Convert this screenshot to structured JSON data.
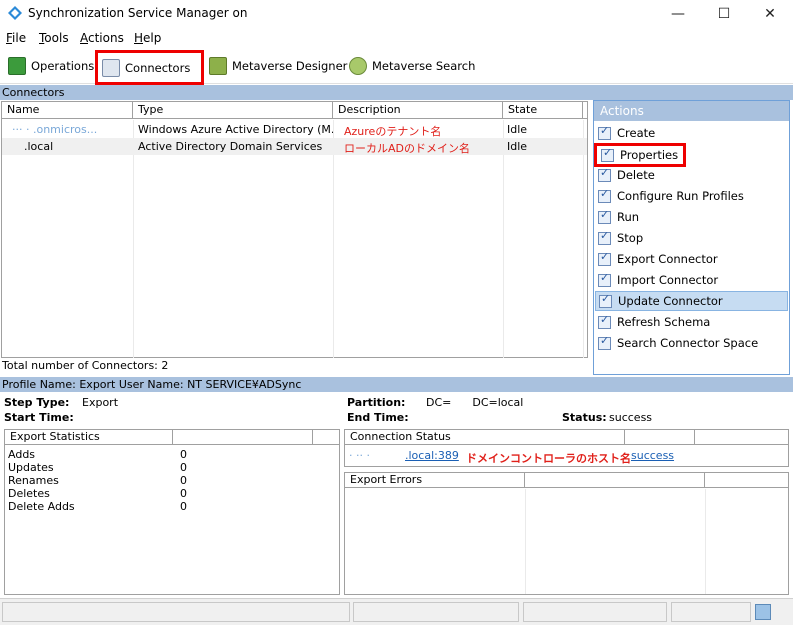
{
  "window": {
    "title": "Synchronization Service Manager on",
    "min": "—",
    "max": "☐",
    "close": "✕"
  },
  "menu": [
    "File",
    "Tools",
    "Actions",
    "Help"
  ],
  "toolbar": {
    "operations": "Operations",
    "connectors": "Connectors",
    "metaverse_designer": "Metaverse Designer",
    "metaverse_search": "Metaverse Search"
  },
  "connectors": {
    "section_title": "Connectors",
    "columns": [
      "Name",
      "Type",
      "Description",
      "State"
    ],
    "rows": [
      {
        "name": "···  ·  .onmicros...",
        "type": "Windows Azure Active Directory (M...",
        "description": "Azureのテナント名",
        "state": "Idle"
      },
      {
        "name": ".local",
        "type": "Active Directory Domain Services",
        "description": "ローカルADのドメイン名",
        "state": "Idle"
      }
    ],
    "total": "Total number of Connectors: 2"
  },
  "actions": {
    "title": "Actions",
    "items": [
      "Create",
      "Properties",
      "Delete",
      "Configure Run Profiles",
      "Run",
      "Stop",
      "Export Connector",
      "Import Connector",
      "Update Connector",
      "Refresh Schema",
      "Search Connector Space"
    ],
    "selected": "Update Connector"
  },
  "profile": {
    "bar": "Profile Name: Export  User Name: NT SERVICE¥ADSync",
    "step_type_label": "Step Type:",
    "step_type_value": "Export",
    "start_time_label": "Start Time:",
    "partition_label": "Partition:",
    "partition_value": "DC=      DC=local",
    "end_time_label": "End Time:",
    "status_label": "Status:",
    "status_value": "success"
  },
  "export_stats": {
    "title": "Export Statistics",
    "rows": [
      {
        "label": "Adds",
        "value": "0"
      },
      {
        "label": "Updates",
        "value": "0"
      },
      {
        "label": "Renames",
        "value": "0"
      },
      {
        "label": "Deletes",
        "value": "0"
      },
      {
        "label": "Delete Adds",
        "value": "0"
      }
    ]
  },
  "connection_status": {
    "title": "Connection Status",
    "host_link": ".local:389",
    "host_prefix": "· ··  ·",
    "annotation": "ドメインコントローラのホスト名",
    "result": "success"
  },
  "export_errors": {
    "title": "Export Errors"
  },
  "colors": {
    "section": "#a9c1de",
    "highlight_red": "#e00000",
    "selected": "#c6dcf2"
  }
}
